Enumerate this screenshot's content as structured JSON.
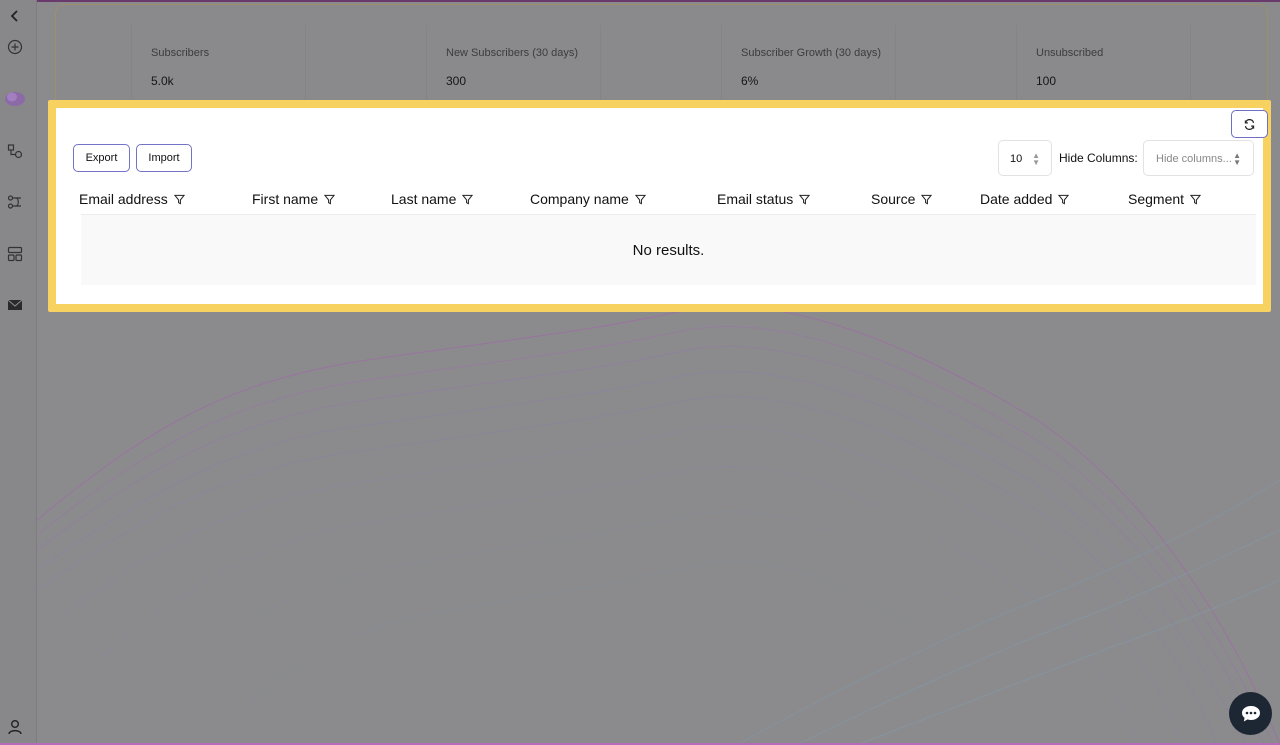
{
  "stats": [
    {
      "label": "Subscribers",
      "value": "5.0k"
    },
    {
      "label": "New Subscribers (30 days)",
      "value": "300"
    },
    {
      "label": "Subscriber Growth (30 days)",
      "value": "6%"
    },
    {
      "label": "Unsubscribed",
      "value": "100"
    }
  ],
  "toolbar": {
    "export_label": "Export",
    "import_label": "Import",
    "page_size": "10",
    "hide_columns_label": "Hide Columns:",
    "hide_columns_placeholder": "Hide columns..."
  },
  "table": {
    "columns": [
      "Email address",
      "First name",
      "Last name",
      "Company name",
      "Email status",
      "Source",
      "Date added",
      "Segment"
    ],
    "empty_text": "No results."
  },
  "colors": {
    "highlight": "#f7d260",
    "button_border": "#7373c8",
    "chat_button": "#1d2733"
  },
  "icons": {
    "sidebar": [
      "collapse-chevron-icon",
      "add-circle-icon",
      "cloud-icon",
      "workflow-icon",
      "automation-icon",
      "templates-icon",
      "mail-icon",
      "user-icon"
    ],
    "refresh": "refresh-icon",
    "filter": "filter-icon",
    "chat": "chat-icon"
  }
}
